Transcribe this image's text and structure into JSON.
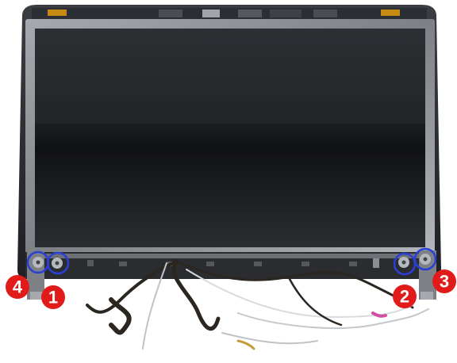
{
  "figure": {
    "subject": "lcd-display-assembly",
    "callouts": [
      {
        "label": "1",
        "target": "screw-1"
      },
      {
        "label": "2",
        "target": "screw-2"
      },
      {
        "label": "3",
        "target": "screw-3"
      },
      {
        "label": "4",
        "target": "screw-4"
      }
    ],
    "colors": {
      "callout_fill": "#e11a1a",
      "callout_text": "#ffffff",
      "highlight_ring": "#2a3fd6",
      "panel": "#17191c",
      "bezel": "#8e9296",
      "background": "#ffffff"
    }
  }
}
